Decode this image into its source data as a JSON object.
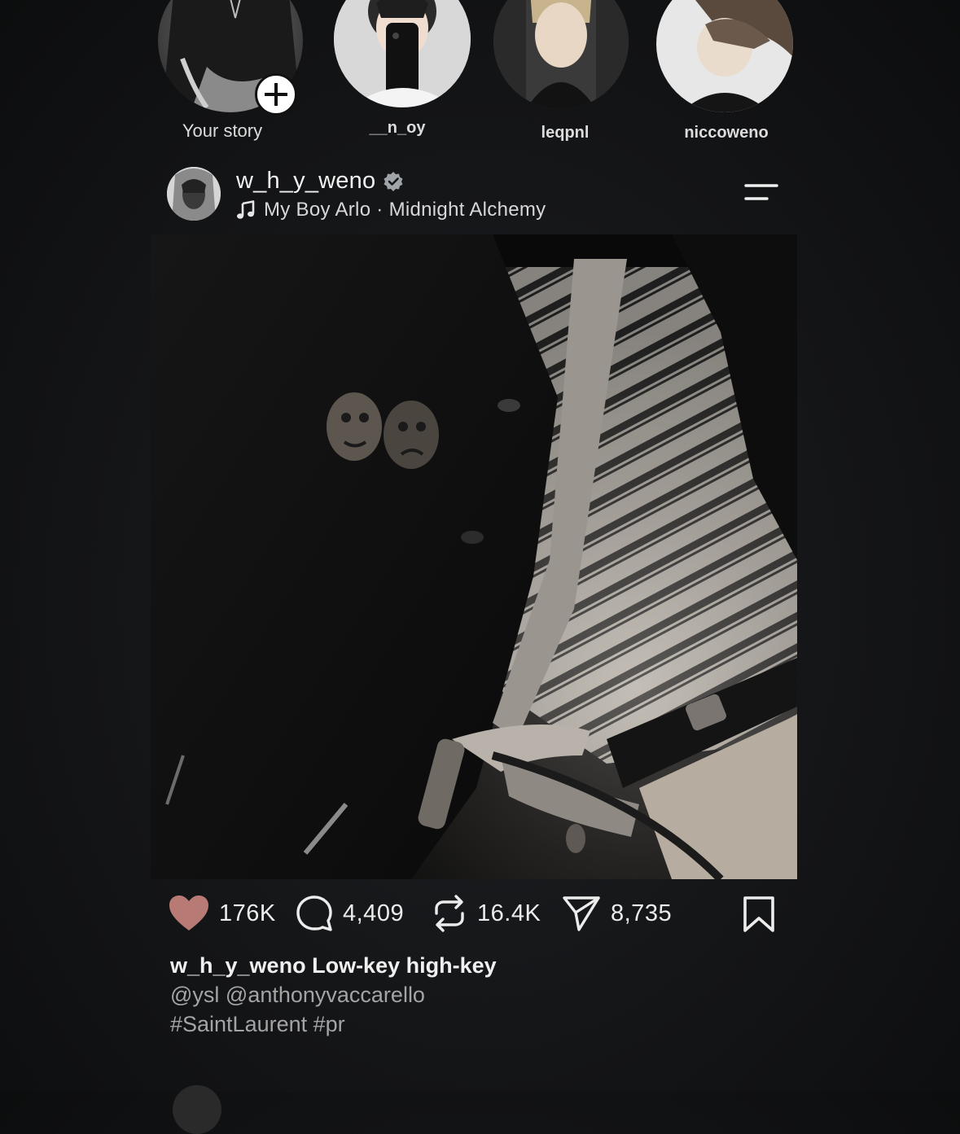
{
  "stories": [
    {
      "label": "Your story",
      "is_own": true
    },
    {
      "label": "__n_oy"
    },
    {
      "label": "leqpnl"
    },
    {
      "label": "niccoweno"
    }
  ],
  "post": {
    "username": "w_h_y_weno",
    "verified": true,
    "music": "My Boy Arlo · Midnight Alchemy",
    "actions": {
      "likes": "176K",
      "comments": "4,409",
      "reposts": "16.4K",
      "shares": "8,735"
    },
    "caption": {
      "username": "w_h_y_weno",
      "text": "Low-key high-key",
      "mentions": "@ysl @anthonyvaccarello",
      "hashtags": "#SaintLaurent #pr"
    }
  },
  "colors": {
    "background": "#141517",
    "heart": "#b77a74",
    "text": "#ececec",
    "muted": "#a4a4a4"
  },
  "icons": [
    "plus-icon",
    "verified-icon",
    "music-note-icon",
    "menu-icon",
    "heart-icon",
    "comment-icon",
    "repost-icon",
    "share-icon",
    "bookmark-icon"
  ]
}
